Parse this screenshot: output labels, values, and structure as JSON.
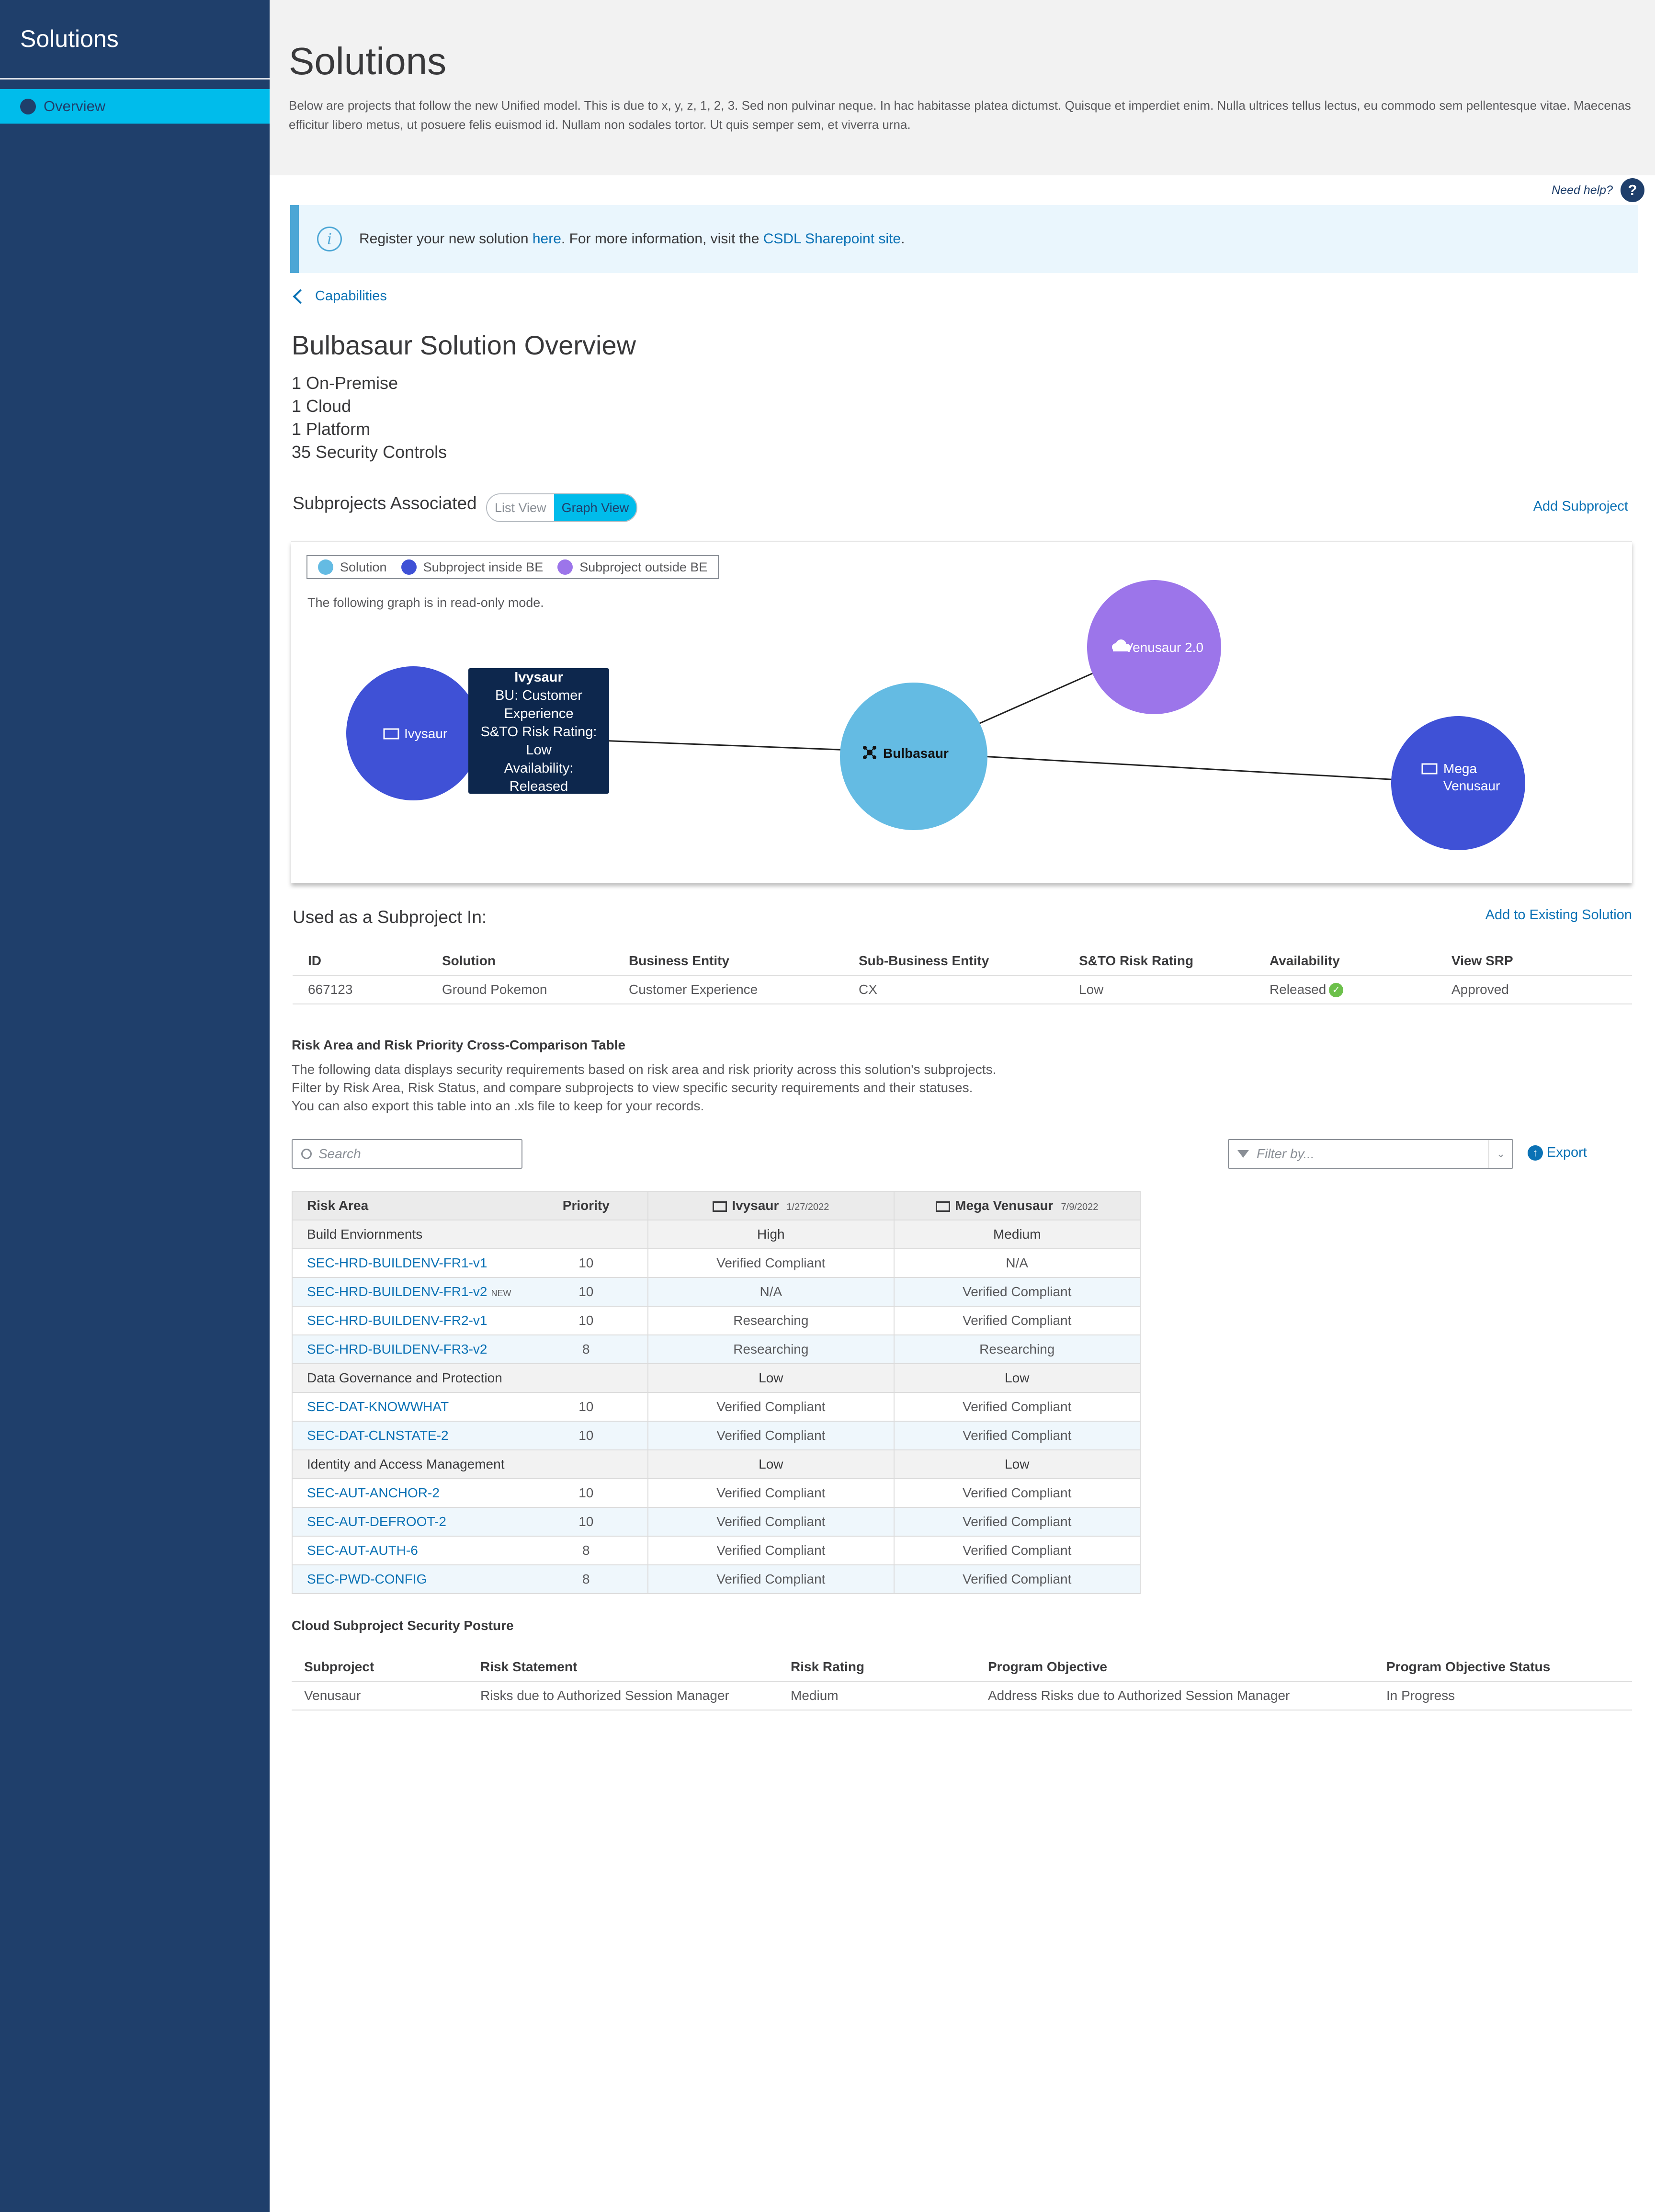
{
  "sidebar": {
    "brand": "Solutions",
    "items": [
      {
        "label": "Overview",
        "active": true
      }
    ]
  },
  "header": {
    "title": "Solutions",
    "description": "Below are projects that follow the new Unified model. This is due to x, y, z, 1, 2, 3. Sed non pulvinar neque. In hac habitasse platea dictumst. Quisque et imperdiet enim. Nulla ultrices tellus lectus, eu commodo sem pellentesque vitae. Maecenas efficitur libero metus, ut posuere felis euismod id. Nullam non sodales tortor. Ut quis semper sem, et viverra urna."
  },
  "help": {
    "label": "Need help?",
    "icon": "?"
  },
  "banner": {
    "prefix": "Register your new solution ",
    "link1": "here",
    "middle": ". For more information, visit the ",
    "link2": "CSDL Sharepoint site",
    "suffix": "."
  },
  "breadcrumb": {
    "back_label": "Capabilities"
  },
  "overview": {
    "title": "Bulbasaur Solution Overview",
    "stats": [
      "1 On-Premise",
      "1 Cloud",
      "1 Platform",
      "35 Security Controls"
    ]
  },
  "subprojects": {
    "heading": "Subprojects Associated",
    "toggle": {
      "list_label": "List View",
      "graph_label": "Graph View",
      "active": "graph"
    },
    "add_label": "Add Subproject",
    "legend": [
      {
        "label": "Solution",
        "color": "#64bbe3"
      },
      {
        "label": "Subproject inside BE",
        "color": "#3f51d6"
      },
      {
        "label": "Subproject outside BE",
        "color": "#9c75ea"
      }
    ],
    "readonly_note": "The following graph is in read-only mode.",
    "nodes": {
      "ivysaur": {
        "label": "Ivysaur",
        "icon": "monitor-icon"
      },
      "bulbasaur": {
        "label": "Bulbasaur",
        "icon": "network-icon"
      },
      "venusaur2": {
        "label": "Venusaur 2.0",
        "icon": "cloud-icon"
      },
      "mega_line1": "Mega",
      "mega_line2": "Venusaur",
      "mega_icon": "monitor-icon"
    },
    "tooltip": {
      "title": "Ivysaur",
      "line1": "BU: Customer",
      "line2": "Experience",
      "line3": "S&TO Risk Rating:",
      "line4": "Low",
      "line5": "Availability:",
      "line6": "Released"
    }
  },
  "used_in": {
    "heading": "Used as a Subproject In:",
    "add_label": "Add to Existing Solution",
    "columns": [
      "ID",
      "Solution",
      "Business Entity",
      "Sub-Business Entity",
      "S&TO Risk Rating",
      "Availability",
      "View SRP"
    ],
    "rows": [
      {
        "id": "667123",
        "solution": "Ground Pokemon",
        "business_entity": "Customer Experience",
        "sub_business_entity": "CX",
        "risk_rating": "Low",
        "availability": "Released",
        "view_srp": "Approved"
      }
    ]
  },
  "risk": {
    "title": "Risk Area and Risk Priority Cross-Comparison Table",
    "desc1": "The following data displays security requirements based on risk area and risk priority across this solution's subprojects.",
    "desc2": "Filter by Risk Area, Risk Status, and compare subprojects to view specific security requirements and their statuses.",
    "desc3": "You can also export this table into an .xls file to keep for your records.",
    "search_placeholder": "Search",
    "filter_placeholder": "Filter by...",
    "export_label": "Export",
    "columns": {
      "risk_area": "Risk Area",
      "priority": "Priority",
      "sub1": "Ivysaur",
      "sub1_date": "1/27/2022",
      "sub2": "Mega Venusaur",
      "sub2_date": "7/9/2022"
    },
    "rows": [
      {
        "type": "group",
        "name": "Build Enviornments",
        "a": "High",
        "b": "Medium"
      },
      {
        "type": "req",
        "name": "SEC-HRD-BUILDENV-FR1-v1",
        "priority": "10",
        "a": "Verified Compliant",
        "b": "N/A"
      },
      {
        "type": "req",
        "name": "SEC-HRD-BUILDENV-FR1-v2",
        "tag": "NEW",
        "priority": "10",
        "a": "N/A",
        "b": "Verified Compliant"
      },
      {
        "type": "req",
        "name": "SEC-HRD-BUILDENV-FR2-v1",
        "priority": "10",
        "a": "Researching",
        "b": "Verified Compliant"
      },
      {
        "type": "req",
        "name": "SEC-HRD-BUILDENV-FR3-v2",
        "priority": "8",
        "a": "Researching",
        "b": "Researching"
      },
      {
        "type": "group",
        "name": "Data Governance and Protection",
        "a": "Low",
        "b": "Low"
      },
      {
        "type": "req",
        "name": "SEC-DAT-KNOWWHAT",
        "priority": "10",
        "a": "Verified Compliant",
        "b": "Verified Compliant"
      },
      {
        "type": "req",
        "name": "SEC-DAT-CLNSTATE-2",
        "priority": "10",
        "a": "Verified Compliant",
        "b": "Verified Compliant"
      },
      {
        "type": "group",
        "name": "Identity and Access Management",
        "a": "Low",
        "b": "Low"
      },
      {
        "type": "req",
        "name": "SEC-AUT-ANCHOR-2",
        "priority": "10",
        "a": "Verified Compliant",
        "b": "Verified Compliant"
      },
      {
        "type": "req",
        "name": "SEC-AUT-DEFROOT-2",
        "priority": "10",
        "a": "Verified Compliant",
        "b": "Verified Compliant"
      },
      {
        "type": "req",
        "name": "SEC-AUT-AUTH-6",
        "priority": "8",
        "a": "Verified Compliant",
        "b": "Verified Compliant"
      },
      {
        "type": "req",
        "name": "SEC-PWD-CONFIG",
        "priority": "8",
        "a": "Verified Compliant",
        "b": "Verified Compliant"
      }
    ]
  },
  "cloud": {
    "title": "Cloud Subproject Security Posture",
    "columns": [
      "Subproject",
      "Risk Statement",
      "Risk Rating",
      "Program Objective",
      "Program Objective Status"
    ],
    "rows": [
      {
        "subproject": "Venusaur",
        "risk_statement": "Risks due to Authorized Session Manager",
        "risk_rating": "Medium",
        "program_objective": "Address Risks due to Authorized Session Manager",
        "status": "In Progress"
      }
    ]
  },
  "colors": {
    "sidebar": "#1f3f6b",
    "accent": "#00bceb",
    "link": "#0b72b5",
    "high": "#cf2030",
    "medium": "#c48a2c",
    "low": "#4e9a1c"
  }
}
